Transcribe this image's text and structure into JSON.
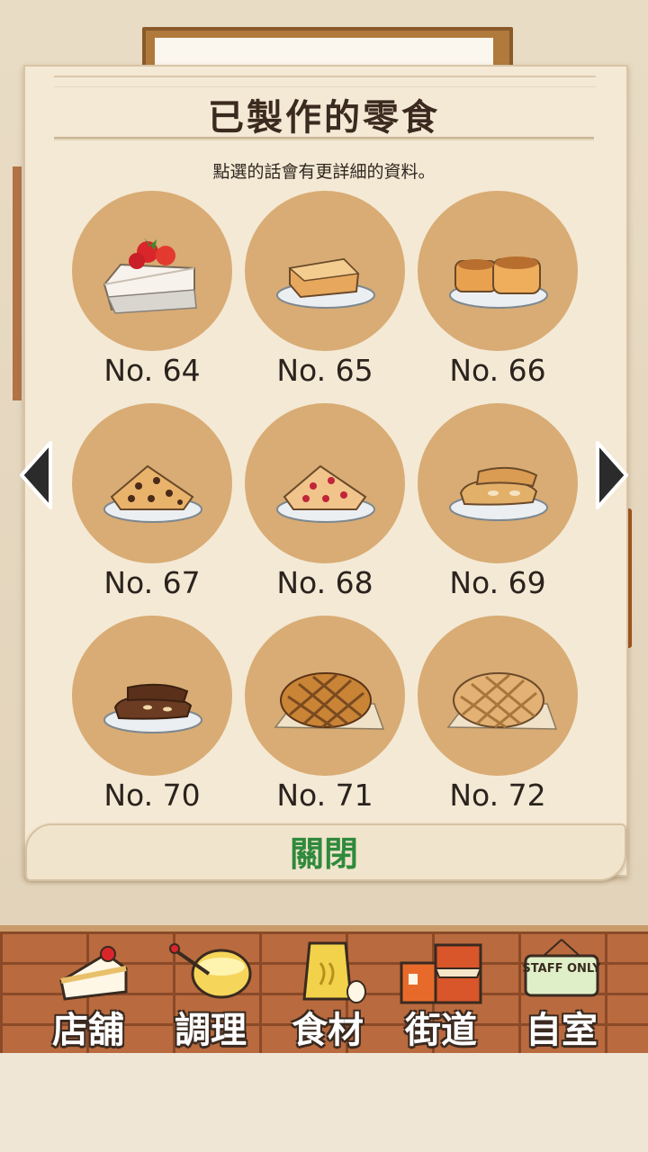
{
  "dialog": {
    "title": "已製作的零食",
    "subtitle": "點選的話會有更詳細的資料。",
    "close_label": "關閉"
  },
  "snacks": [
    {
      "label": "No. 64",
      "icon": "strawberry-cake-icon"
    },
    {
      "label": "No. 65",
      "icon": "french-toast-icon"
    },
    {
      "label": "No. 66",
      "icon": "biscuits-icon"
    },
    {
      "label": "No. 67",
      "icon": "chocolate-chip-scone-icon"
    },
    {
      "label": "No. 68",
      "icon": "berry-scone-icon"
    },
    {
      "label": "No. 69",
      "icon": "biscotti-icon"
    },
    {
      "label": "No. 70",
      "icon": "chocolate-biscotti-icon"
    },
    {
      "label": "No. 71",
      "icon": "waffle-icon"
    },
    {
      "label": "No. 72",
      "icon": "plain-waffle-icon"
    }
  ],
  "nav": [
    {
      "label": "店舖",
      "icon": "cake-shop-icon"
    },
    {
      "label": "調理",
      "icon": "cooking-bowl-icon"
    },
    {
      "label": "食材",
      "icon": "ingredients-bag-icon"
    },
    {
      "label": "街道",
      "icon": "street-buildings-icon"
    },
    {
      "label": "自室",
      "icon": "staff-only-sign-icon",
      "sign_text": "STAFF ONLY"
    }
  ],
  "colors": {
    "circle": "#d8ac74",
    "close_text": "#2f8a3c",
    "panel": "#f4e9d5",
    "brick": "#b96a3e"
  }
}
